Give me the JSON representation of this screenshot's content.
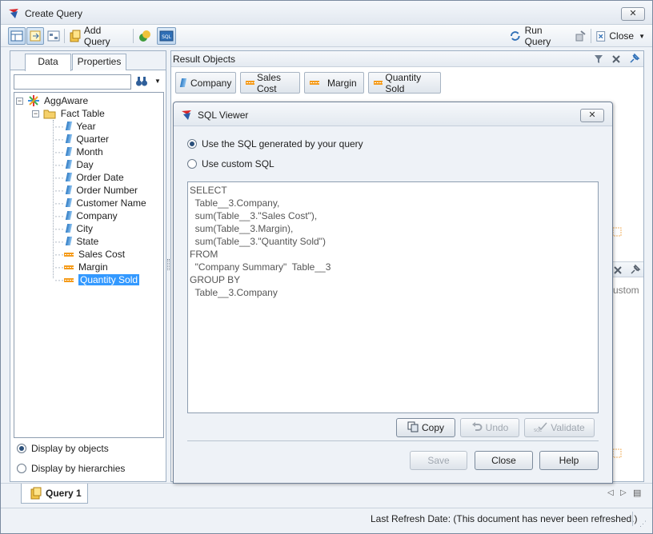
{
  "window": {
    "title": "Create Query"
  },
  "toolbar": {
    "add_query": "Add Query",
    "run_query": "Run Query",
    "close": "Close"
  },
  "left_panel": {
    "tabs": [
      "Data",
      "Properties"
    ],
    "search_value": "",
    "tree": {
      "root": "AggAware",
      "folder": "Fact Table",
      "items": [
        {
          "label": "Year",
          "kind": "dimension"
        },
        {
          "label": "Quarter",
          "kind": "dimension"
        },
        {
          "label": "Month",
          "kind": "dimension"
        },
        {
          "label": "Day",
          "kind": "dimension"
        },
        {
          "label": "Order Date",
          "kind": "dimension"
        },
        {
          "label": "Order Number",
          "kind": "dimension"
        },
        {
          "label": "Customer Name",
          "kind": "dimension"
        },
        {
          "label": "Company",
          "kind": "dimension"
        },
        {
          "label": "City",
          "kind": "dimension"
        },
        {
          "label": "State",
          "kind": "dimension"
        },
        {
          "label": "Sales Cost",
          "kind": "measure"
        },
        {
          "label": "Margin",
          "kind": "measure"
        },
        {
          "label": "Quantity Sold",
          "kind": "measure",
          "selected": true
        }
      ]
    },
    "display_by_objects": "Display by objects",
    "display_by_hierarchies": "Display by hierarchies"
  },
  "result_objects": {
    "title": "Result Objects",
    "items": [
      "Company",
      "Sales Cost",
      "Margin",
      "Quantity Sold"
    ],
    "partial_text": "ustom"
  },
  "sql_viewer": {
    "title": "SQL Viewer",
    "option_generated": "Use the SQL generated by your query",
    "option_custom": "Use custom SQL",
    "sql_text": "SELECT\n  Table__3.Company,\n  sum(Table__3.\"Sales Cost\"),\n  sum(Table__3.Margin),\n  sum(Table__3.\"Quantity Sold\")\nFROM\n  \"Company Summary\"  Table__3\nGROUP BY\n  Table__3.Company",
    "copy": "Copy",
    "undo": "Undo",
    "validate": "Validate",
    "save": "Save",
    "close": "Close",
    "help": "Help"
  },
  "query_tab": "Query 1",
  "status": {
    "last_refresh": "Last Refresh Date: (This document has never been refreshed.)"
  },
  "colors": {
    "selection": "#3399ff",
    "measure": "#f59b1a",
    "dimension": "#2e7bc4"
  }
}
